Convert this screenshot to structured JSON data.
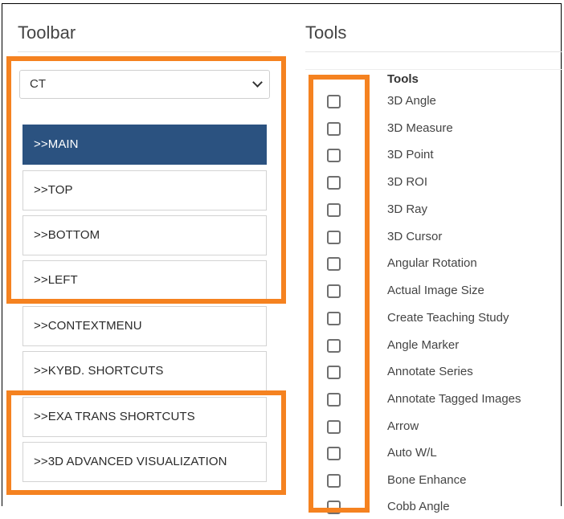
{
  "toolbar": {
    "heading": "Toolbar",
    "modality_select": {
      "value": "CT"
    },
    "sections": [
      {
        "label": ">>MAIN",
        "active": true
      },
      {
        "label": ">>TOP",
        "active": false
      },
      {
        "label": ">>BOTTOM",
        "active": false
      },
      {
        "label": ">>LEFT",
        "active": false
      },
      {
        "label": ">>CONTEXTMENU",
        "active": false
      },
      {
        "label": ">>KYBD. SHORTCUTS",
        "active": false
      },
      {
        "label": ">>EXA TRANS SHORTCUTS",
        "active": false
      },
      {
        "label": ">>3D ADVANCED VISUALIZATION",
        "active": false
      }
    ]
  },
  "tools": {
    "heading": "Tools",
    "column_header": "Tools",
    "items": [
      {
        "label": "3D Angle",
        "checked": false
      },
      {
        "label": "3D Measure",
        "checked": false
      },
      {
        "label": "3D Point",
        "checked": false
      },
      {
        "label": "3D ROI",
        "checked": false
      },
      {
        "label": "3D Ray",
        "checked": false
      },
      {
        "label": "3D Cursor",
        "checked": false
      },
      {
        "label": "Angular Rotation",
        "checked": false
      },
      {
        "label": "Actual Image Size",
        "checked": false
      },
      {
        "label": "Create Teaching Study",
        "checked": false
      },
      {
        "label": "Angle Marker",
        "checked": false
      },
      {
        "label": "Annotate Series",
        "checked": false
      },
      {
        "label": "Annotate Tagged Images",
        "checked": false
      },
      {
        "label": "Arrow",
        "checked": false
      },
      {
        "label": "Auto W/L",
        "checked": false
      },
      {
        "label": "Bone Enhance",
        "checked": false
      },
      {
        "label": "Cobb Angle",
        "checked": false
      }
    ]
  },
  "colors": {
    "active_button": "#2b5280",
    "highlight_outline": "#f58220"
  },
  "icons": {
    "select_arrow": "chevron-down-icon"
  }
}
